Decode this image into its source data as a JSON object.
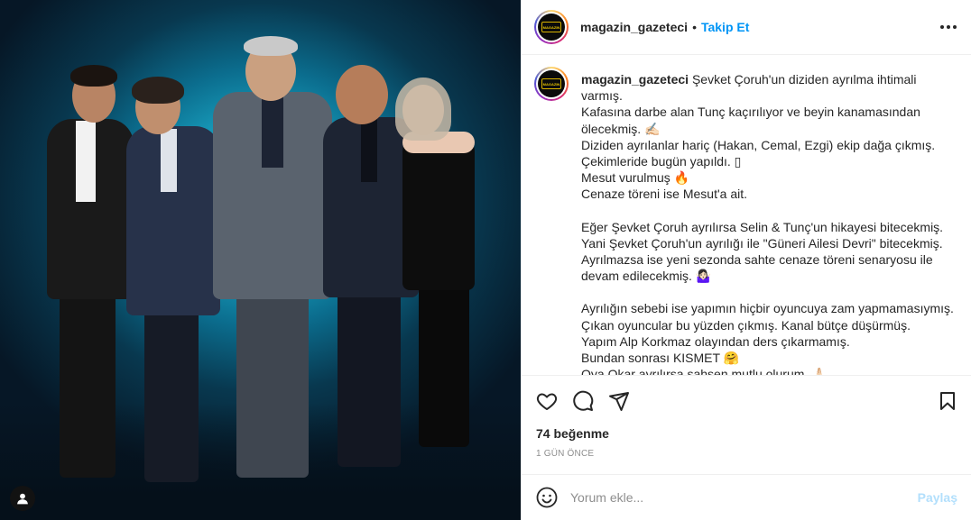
{
  "post": {
    "username": "magazin_gazeteci",
    "separator": "•",
    "follow_label": "Takip Et",
    "avatar_logo_text": "MAGAZIN",
    "caption_lines": [
      "Şevket Çoruh'un diziden ayrılma ihtimali",
      "varmış.",
      "Kafasına darbe alan Tunç kaçırılıyor ve beyin kanamasından",
      "ölecekmiş. ✍🏻",
      "Diziden ayrılanlar hariç (Hakan, Cemal, Ezgi) ekip dağa çıkmış.",
      "Çekimleride bugün yapıldı. ▯",
      "Mesut vurulmuş 🔥",
      "Cenaze töreni ise Mesut'a ait.",
      "",
      "Eğer Şevket Çoruh ayrılırsa Selin & Tunç'un hikayesi bitecekmiş.",
      "Yani Şevket Çoruh'un ayrılığı ile \"Güneri Ailesi Devri\" bitecekmiş.",
      "Ayrılmazsa ise yeni sezonda sahte cenaze töreni senaryosu ile",
      "devam edilecekmiş. 🤷🏻‍♀️",
      "",
      "Ayrılığın sebebi ise yapımın hiçbir oyuncuya zam yapmamasıymış.",
      "Çıkan oyuncular bu yüzden çıkmış. Kanal bütçe düşürmüş.",
      "Yapım Alp Korkmaz olayından ders çıkarmamış.",
      "Bundan sonrası KISMET 🤗",
      "Oya Okar ayrılırsa şahsen mutlu olurum. 🙏🏻"
    ],
    "likes": "74 beğenme",
    "time": "1 GÜN ÖNCE",
    "comment_placeholder": "Yorum ekle...",
    "share_label": "Paylaş"
  },
  "icons": {
    "more": "more-horizontal-icon",
    "like": "heart-icon",
    "comment": "comment-icon",
    "share": "paper-plane-icon",
    "save": "bookmark-icon",
    "emoji": "smiley-icon",
    "tagged_user": "user-icon"
  },
  "colors": {
    "accent": "#0095f6",
    "text": "#262626",
    "muted": "#8e8e8e",
    "share_disabled": "#b2dffc",
    "border": "#efefef"
  }
}
